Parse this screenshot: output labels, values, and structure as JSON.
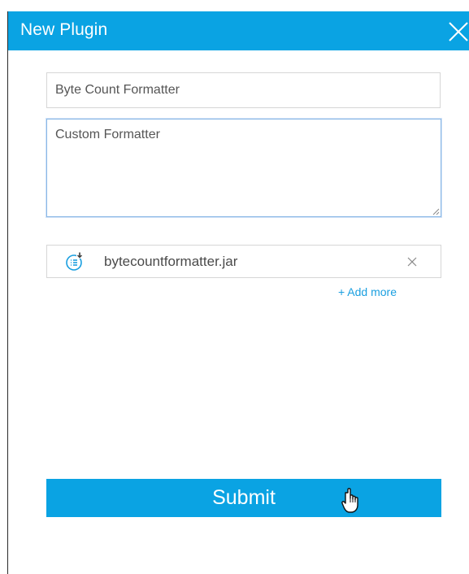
{
  "dialog": {
    "title": "New Plugin",
    "close_icon": "close-icon"
  },
  "form": {
    "name_value": "Byte Count Formatter",
    "description_value": "Custom Formatter",
    "file": {
      "icon": "file-list-download-icon",
      "name": "bytecountformatter.jar",
      "remove_icon": "close-icon"
    },
    "add_more_label": "+ Add more",
    "submit_label": "Submit"
  },
  "cursor": {
    "icon": "hand-pointer-icon"
  },
  "colors": {
    "accent": "#0aa3e3",
    "link": "#1a9fe0",
    "border": "#d6d6d6",
    "focus_border": "#8ab8e6",
    "text": "#555555"
  }
}
